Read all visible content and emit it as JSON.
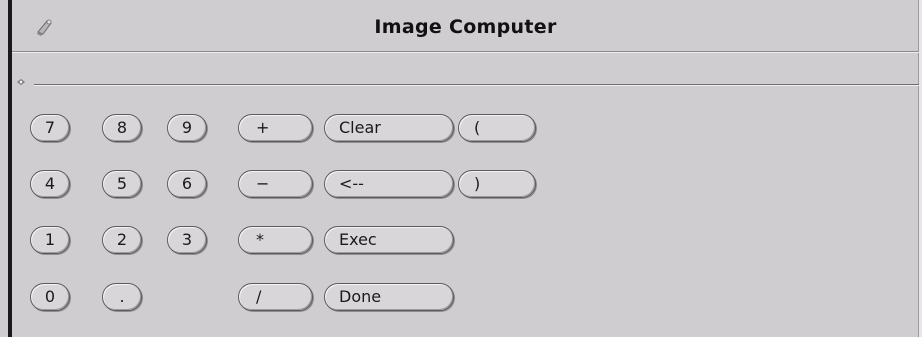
{
  "window": {
    "title": "Image Computer",
    "menu_icon": "window-menu-icon",
    "pin_icon": "pushpin-icon"
  },
  "display": {
    "value": ""
  },
  "keypad": {
    "digits": {
      "seven": "7",
      "eight": "8",
      "nine": "9",
      "four": "4",
      "five": "5",
      "six": "6",
      "one": "1",
      "two": "2",
      "three": "3",
      "zero": "0",
      "decimal": "."
    },
    "operators": {
      "add": "+",
      "subtract": "−",
      "multiply": "*",
      "divide": "/"
    },
    "functions": {
      "clear": "Clear",
      "backspace": "<--",
      "exec": "Exec",
      "done": "Done",
      "open_paren": "(",
      "close_paren": ")"
    }
  },
  "colors": {
    "background": "#cfcdd0",
    "button_face": "#d8d6d9",
    "button_border": "#5c5a5e",
    "text": "#1a1a1a"
  }
}
